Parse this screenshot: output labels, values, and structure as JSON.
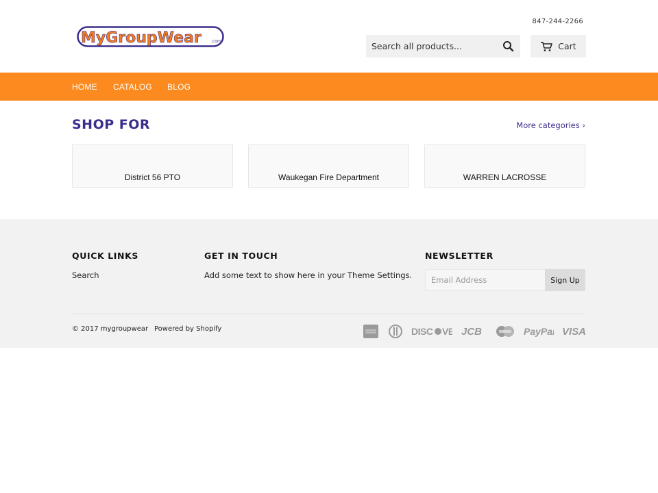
{
  "header": {
    "logo_text": "MyGroupWear",
    "logo_suffix": ".com",
    "phone": "847-244-2266",
    "search_placeholder": "Search all products...",
    "cart_label": "Cart"
  },
  "nav": {
    "items": [
      {
        "label": "HOME"
      },
      {
        "label": "CATALOG"
      },
      {
        "label": "BLOG"
      }
    ]
  },
  "main": {
    "section_title": "SHOP FOR",
    "more_link": "More categories ›",
    "collections": [
      {
        "label": "District 56 PTO"
      },
      {
        "label": "Waukegan Fire Department"
      },
      {
        "label": "WARREN LACROSSE"
      }
    ]
  },
  "footer": {
    "quick_links_heading": "QUICK LINKS",
    "quick_links": [
      {
        "label": "Search"
      }
    ],
    "get_in_touch_heading": "GET IN TOUCH",
    "get_in_touch_text": "Add some text to show here in your Theme Settings.",
    "newsletter_heading": "NEWSLETTER",
    "email_placeholder": "Email Address",
    "signup_label": "Sign Up",
    "copyright": "© 2017 mygroupwear",
    "powered_by": "Powered by Shopify",
    "payment_icons": [
      "american-express-icon",
      "diners-club-icon",
      "discover-icon",
      "jcb-icon",
      "master-icon",
      "paypal-icon",
      "visa-icon"
    ]
  },
  "colors": {
    "nav_bg": "#fc8a1f",
    "title_purple": "#3a2e8c",
    "footer_bg": "#f2f2f2"
  }
}
